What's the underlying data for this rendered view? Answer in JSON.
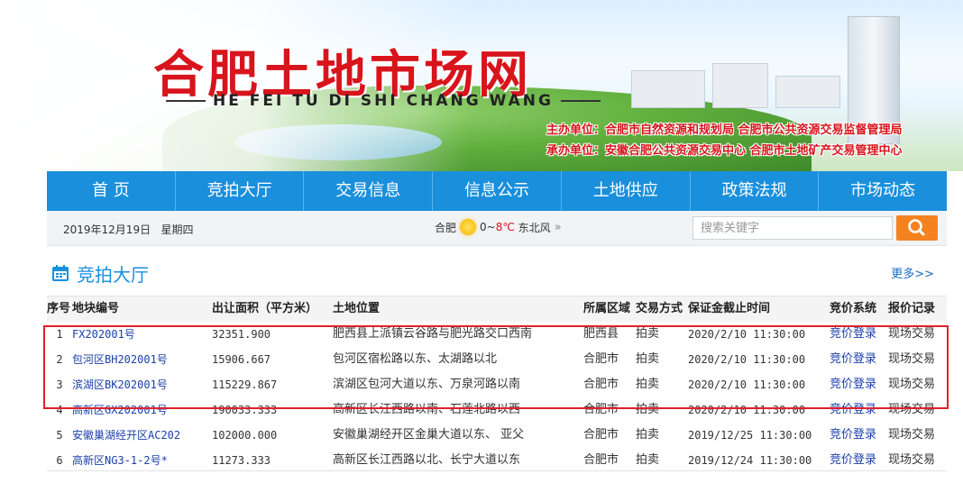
{
  "banner": {
    "title_cn": "合肥土地市场网",
    "title_en": "HE FEI TU DI SHI CHANG WANG",
    "organizer_line": "主办单位：合肥市自然资源和规划局  合肥市公共资源交易监督管理局",
    "undertaker_line": "承办单位：安徽合肥公共资源交易中心  合肥市土地矿产交易管理中心"
  },
  "nav": {
    "items": [
      "首 页",
      "竞拍大厅",
      "交易信息",
      "信息公示",
      "土地供应",
      "政策法规",
      "市场动态"
    ]
  },
  "infobar": {
    "date": "2019年12月19日",
    "weekday": "星期四",
    "weather_city": "合肥",
    "temp_low": "0~",
    "temp_high": "8℃",
    "wind": "东北风",
    "more_arrow": "»",
    "search_placeholder": "搜索关键字"
  },
  "section": {
    "title": "竞拍大厅",
    "more": "更多>>"
  },
  "table": {
    "headers": [
      "序号",
      "地块编号",
      "出让面积（平方米）",
      "土地位置",
      "所属区域",
      "交易方式",
      "保证金截止时间",
      "竞价系统",
      "报价记录"
    ],
    "rows": [
      {
        "seq": "1",
        "code": "FX202001号",
        "area": "32351.900",
        "location": "肥西县上派镇云谷路与肥光路交口西南",
        "region": "肥西县",
        "mode": "拍卖",
        "deadline": "2020/2/10 11:30:00",
        "system": "竞价登录",
        "record": "现场交易"
      },
      {
        "seq": "2",
        "code": "包河区BH202001号",
        "area": "15906.667",
        "location": "包河区宿松路以东、太湖路以北",
        "region": "合肥市",
        "mode": "拍卖",
        "deadline": "2020/2/10 11:30:00",
        "system": "竞价登录",
        "record": "现场交易"
      },
      {
        "seq": "3",
        "code": "滨湖区BK202001号",
        "area": "115229.867",
        "location": "滨湖区包河大道以东、万泉河路以南",
        "region": "合肥市",
        "mode": "拍卖",
        "deadline": "2020/2/10 11:30:00",
        "system": "竞价登录",
        "record": "现场交易"
      },
      {
        "seq": "4",
        "code": "高新区GX202001号",
        "area": "190033.333",
        "location": "高新区长江西路以南、石莲北路以西",
        "region": "合肥市",
        "mode": "拍卖",
        "deadline": "2020/2/10 11:30:00",
        "system": "竞价登录",
        "record": "现场交易"
      },
      {
        "seq": "5",
        "code": "安徽巢湖经开区AC202",
        "area": "102000.000",
        "location": "安徽巢湖经开区金巢大道以东、 亚父",
        "region": "合肥市",
        "mode": "拍卖",
        "deadline": "2019/12/25 11:30:00",
        "system": "竞价登录",
        "record": "现场交易"
      },
      {
        "seq": "6",
        "code": "高新区NG3-1-2号*",
        "area": "11273.333",
        "location": "高新区长江西路以北、长宁大道以东",
        "region": "合肥市",
        "mode": "拍卖",
        "deadline": "2019/12/24 11:30:00",
        "system": "竞价登录",
        "record": "现场交易"
      }
    ]
  },
  "colors": {
    "brand_red": "#d8141c",
    "nav_blue": "#1a8fdc",
    "search_orange": "#f58220",
    "highlight_red": "#e0202a",
    "link_blue": "#1a3fa8"
  }
}
